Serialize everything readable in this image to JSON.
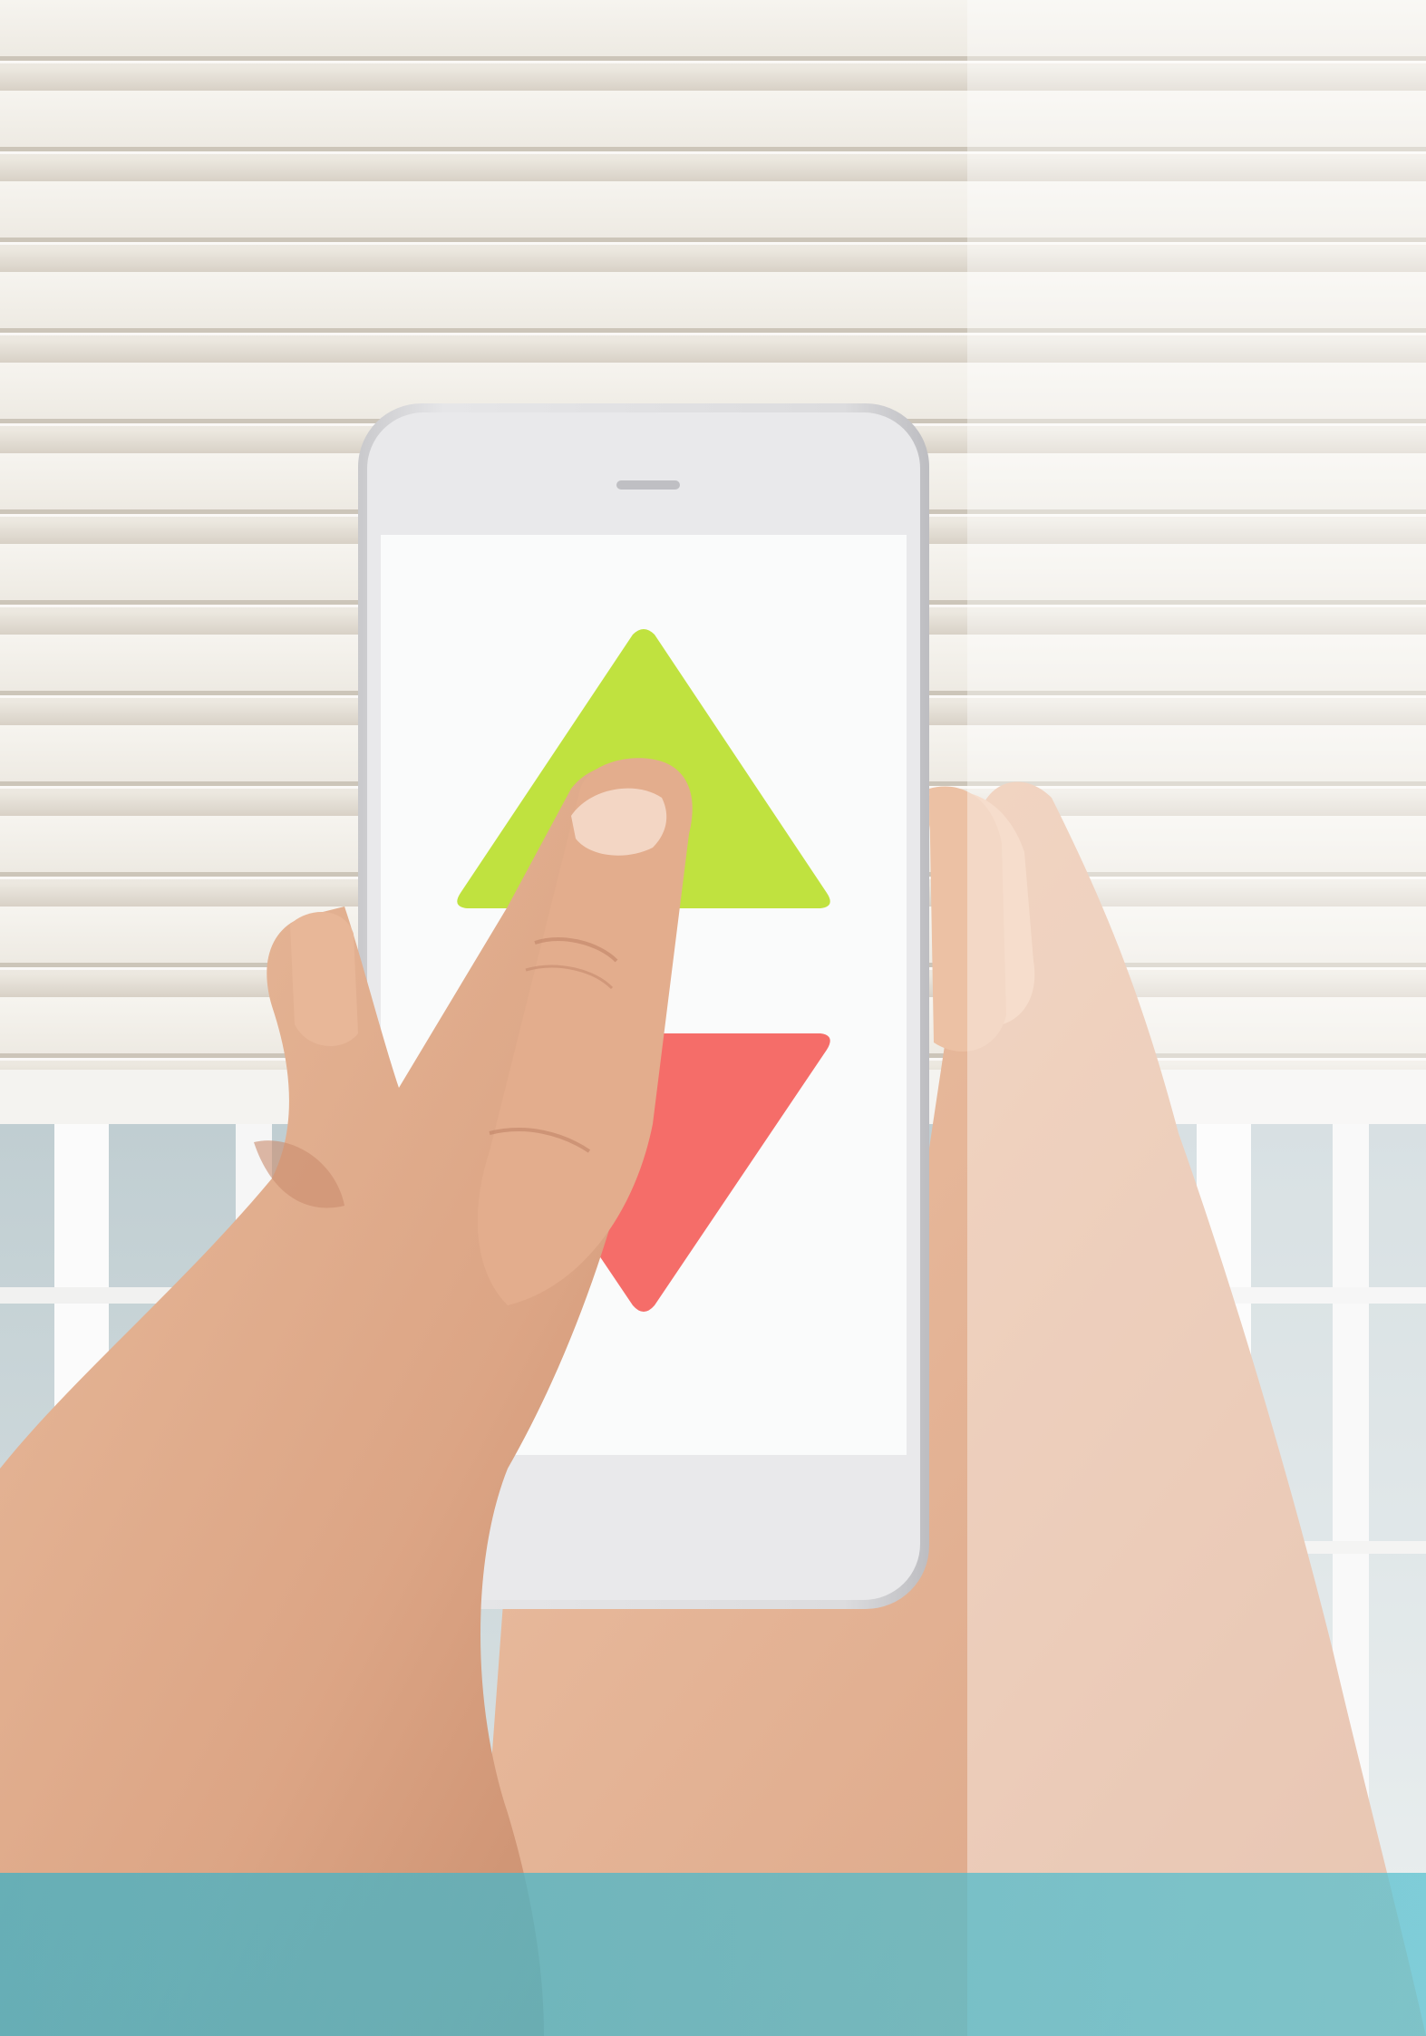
{
  "scene": {
    "subject": "hand-holding-smartphone-with-up-down-arrows",
    "colors": {
      "shutter_light": "#f1eee8",
      "shutter_groove": "#cfc8bd",
      "window_frame": "#ffffff",
      "window_glass": "#cdd8db",
      "phone_body": "#d4d4d6",
      "phone_screen": "#fafbfb",
      "up_arrow": "#c0e23f",
      "down_arrow": "#f56d69",
      "skin": "#e4b394",
      "skin_shadow": "#c98c6e",
      "overlay_light": "#ffffff",
      "band_teal": "#4fb3c3"
    },
    "screen": {
      "up_arrow_icon": "triangle-up-icon",
      "down_arrow_icon": "triangle-down-icon"
    }
  }
}
